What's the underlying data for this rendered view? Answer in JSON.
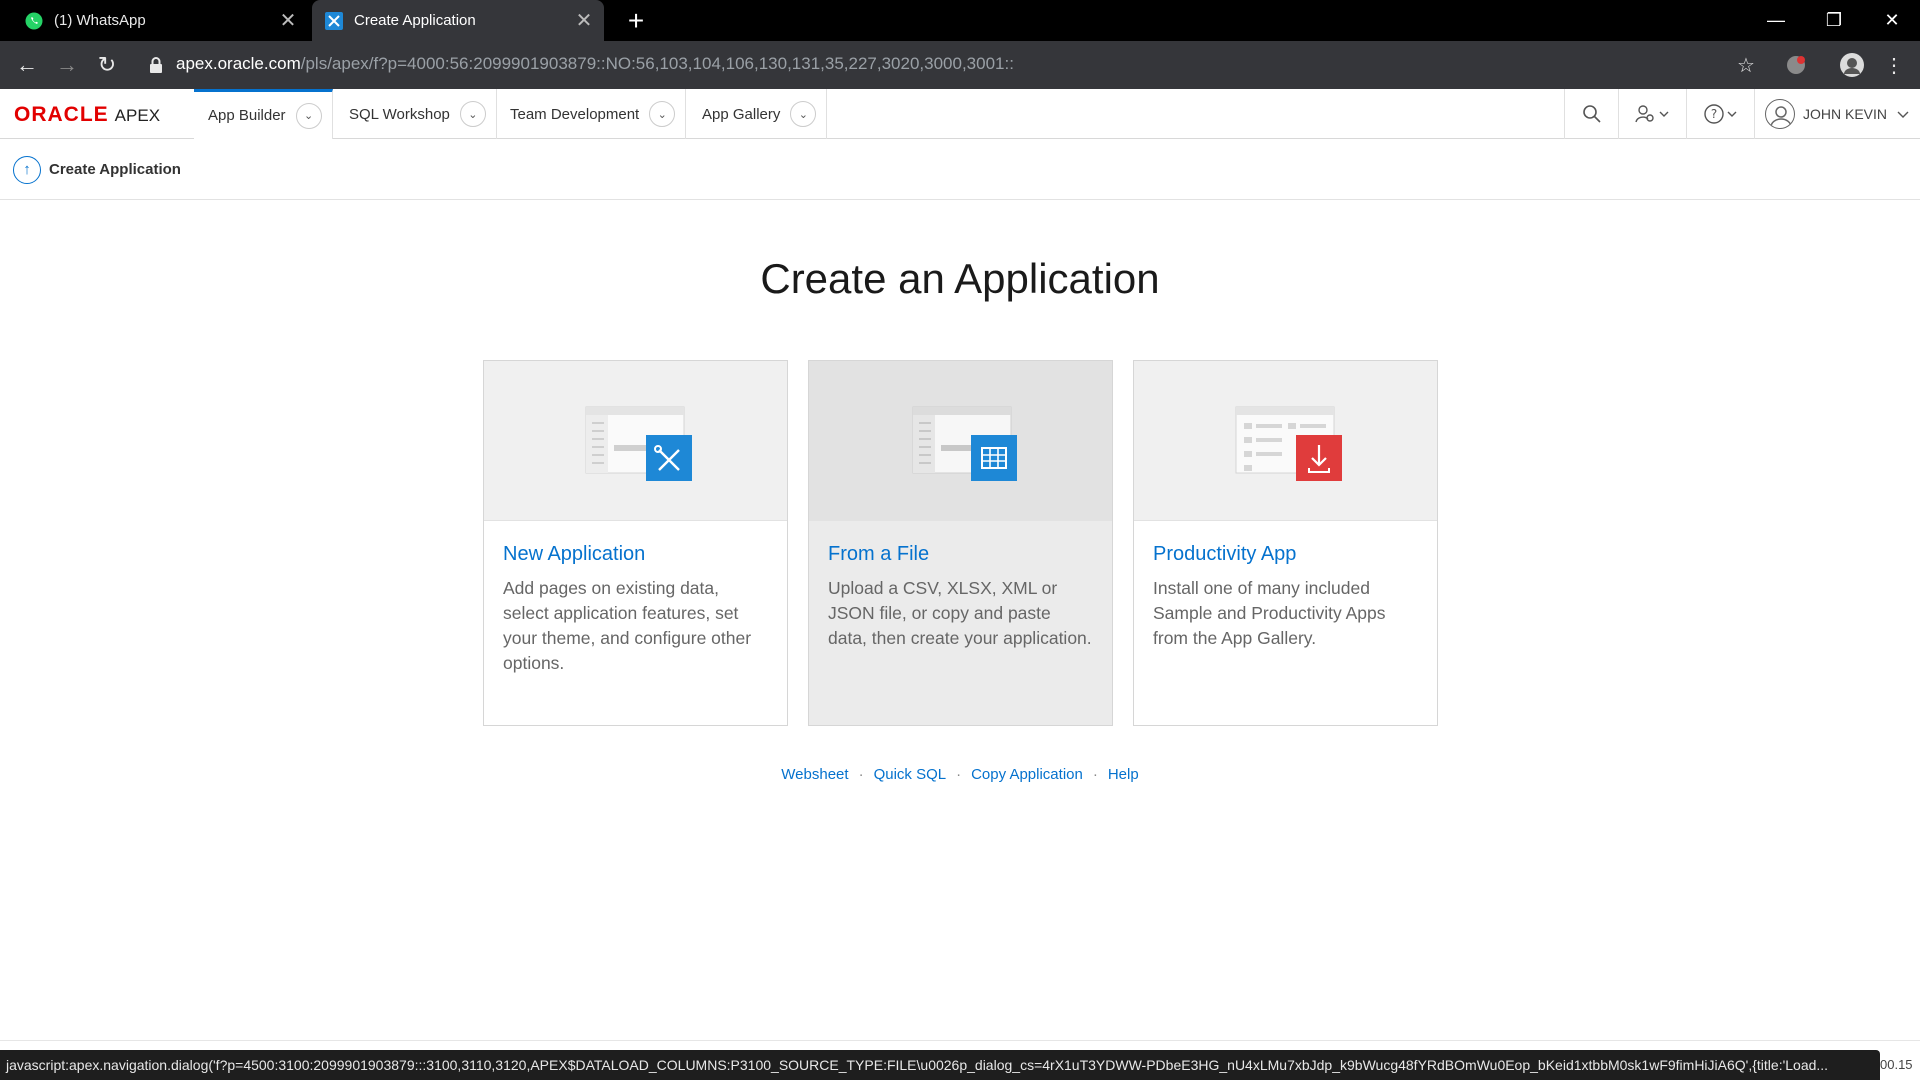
{
  "browser": {
    "tabs": [
      {
        "label": "(1) WhatsApp"
      },
      {
        "label": "Create Application"
      }
    ],
    "url_host": "apex.oracle.com",
    "url_path": "/pls/apex/f?p=4000:56:2099901903879::NO:56,103,104,106,130,131,35,227,3020,3000,3001::"
  },
  "header": {
    "logo_oracle": "ORACLE",
    "logo_apex": "APEX",
    "menus": [
      {
        "label": "App Builder"
      },
      {
        "label": "SQL Workshop"
      },
      {
        "label": "Team Development"
      },
      {
        "label": "App Gallery"
      }
    ],
    "user_name": "JOHN KEVIN"
  },
  "breadcrumb": {
    "label": "Create Application"
  },
  "main": {
    "title": "Create an Application",
    "cards": [
      {
        "title": "New Application",
        "description": "Add pages on existing data, select application features, set your theme, and configure other options.",
        "icon": "wrench-pencil-icon",
        "accent": "#1e88d6"
      },
      {
        "title": "From a File",
        "description": "Upload a CSV, XLSX, XML or JSON file, or copy and paste data, then create your application.",
        "icon": "table-icon",
        "accent": "#1e88d6"
      },
      {
        "title": "Productivity App",
        "description": "Install one of many included Sample and Productivity Apps from the App Gallery.",
        "icon": "download-icon",
        "accent": "#e03c3c"
      }
    ],
    "links": [
      {
        "label": "Websheet"
      },
      {
        "label": "Quick SQL"
      },
      {
        "label": "Copy Application"
      },
      {
        "label": "Help"
      }
    ]
  },
  "status": {
    "url": "javascript:apex.navigation.dialog('f?p=4500:3100:2099901903879:::3100,3110,3120,APEX$DATALOAD_COLUMNS:P3100_SOURCE_TYPE:FILE\\u0026p_dialog_cs=4rX1uT3YDWW-PDbeE3HG_nU4xLMu7xbJdp_k9bWucg48fYRdBOmWu0Eop_bKeid1xtbbM0sk1wF9fimHiJiA6Q',{title:'Load...",
    "right_fragment": "00.15"
  }
}
